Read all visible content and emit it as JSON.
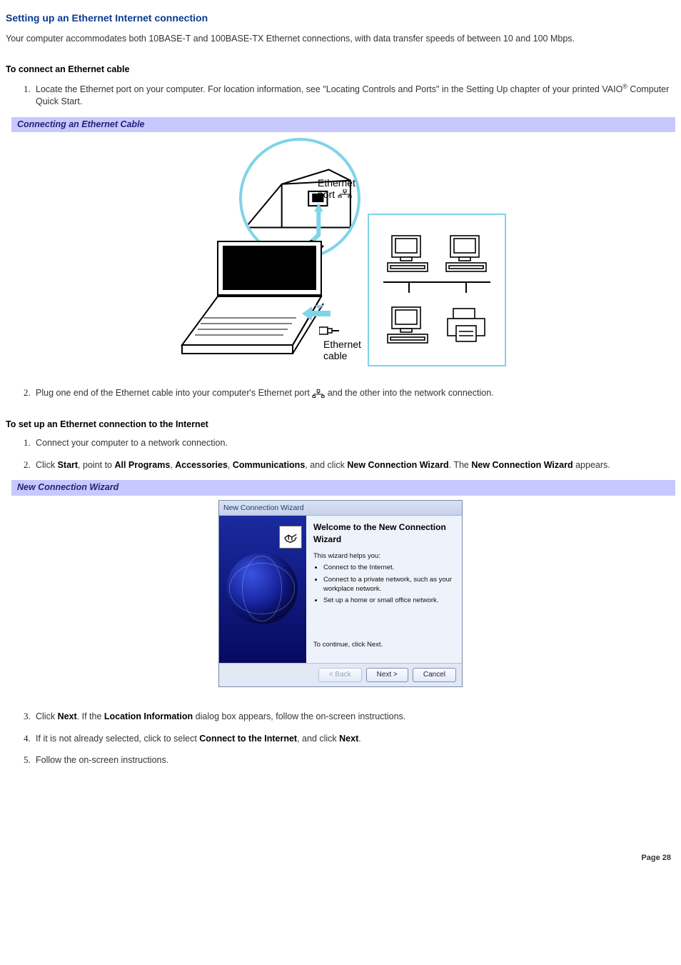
{
  "title": "Setting up an Ethernet Internet connection",
  "intro": "Your computer accommodates both 10BASE-T and 100BASE-TX Ethernet connections, with data transfer speeds of between 10 and 100 Mbps.",
  "sectionA": {
    "heading": "To connect an Ethernet cable",
    "step1_a": "Locate the Ethernet port on your computer. For location information, see \"Locating Controls and Ports\" in the Setting Up chapter of your printed VAIO",
    "step1_b": " Computer Quick Start.",
    "caption": "Connecting an Ethernet Cable",
    "labels": {
      "port": "Ethernet port",
      "cable": "Ethernet cable"
    },
    "step2_a": "Plug one end of the Ethernet cable into your computer's Ethernet port ",
    "step2_b": " and the other into the network connection."
  },
  "sectionB": {
    "heading": "To set up an Ethernet connection to the Internet",
    "step1": "Connect your computer to a network connection.",
    "step2_parts": {
      "a": "Click ",
      "start": "Start",
      "b": ", point to ",
      "all": "All Programs",
      "c": ", ",
      "acc": "Accessories",
      "d": ", ",
      "comm": "Communications",
      "e": ", and click ",
      "ncw": "New Connection Wizard",
      "f": ". The ",
      "ncw2": "New Connection Wizard",
      "g": " appears."
    },
    "caption": "New Connection Wizard",
    "wizard": {
      "window_title": "New Connection Wizard",
      "heading": "Welcome to the New Connection Wizard",
      "helps": "This wizard helps you:",
      "bullets": [
        "Connect to the Internet.",
        "Connect to a private network, such as your workplace network.",
        "Set up a home or small office network."
      ],
      "continue": "To continue, click Next.",
      "buttons": {
        "back": "< Back",
        "next": "Next >",
        "cancel": "Cancel"
      }
    },
    "step3_a": "Click ",
    "step3_next": "Next",
    "step3_b": ". If the ",
    "step3_loc": "Location Information",
    "step3_c": " dialog box appears, follow the on-screen instructions.",
    "step4_a": "If it is not already selected, click to select ",
    "step4_conn": "Connect to the Internet",
    "step4_b": ", and click ",
    "step4_next": "Next",
    "step4_c": ".",
    "step5": "Follow the on-screen instructions."
  },
  "page": "Page 28"
}
